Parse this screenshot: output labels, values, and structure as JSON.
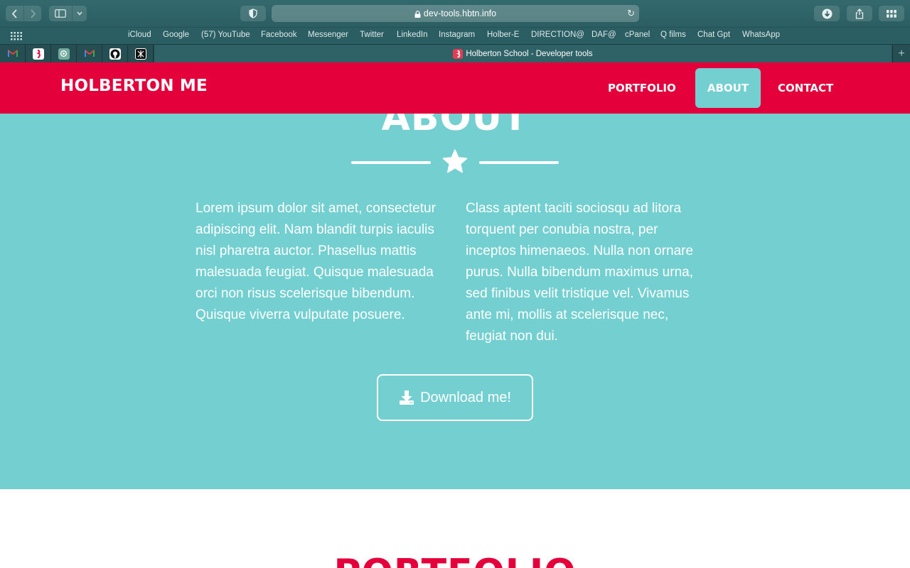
{
  "browser": {
    "url": "dev-tools.hbtn.info",
    "bookmarks": [
      "iCloud",
      "Google",
      "(57) YouTube",
      "Facebook",
      "Messenger",
      "Twitter",
      "LinkedIn",
      "Instagram",
      "Holber-E",
      "DIRECTION@",
      "DAF@",
      "cPanel",
      "Q films",
      "Chat Gpt",
      "WhatsApp"
    ],
    "active_tab_title": "Holberton School - Developer tools",
    "pinned_tabs": [
      "gmail-icon",
      "holberton-icon",
      "chatgpt-icon",
      "gmail-icon",
      "github-icon",
      "app-icon"
    ],
    "new_tab_symbol": "+"
  },
  "site": {
    "brand": "HOLBERTON ME",
    "nav": {
      "portfolio": "PORTFOLIO",
      "about": "ABOUT",
      "contact": "CONTACT"
    },
    "active_nav": "ABOUT",
    "colors": {
      "primary": "#e4003b",
      "secondary": "#74cfd1",
      "text_light": "#ffffff"
    }
  },
  "about": {
    "title": "ABOUT",
    "col1": "Lorem ipsum dolor sit amet, consectetur adipiscing elit. Nam blandit turpis iaculis nisl pharetra auctor. Phasellus mattis malesuada feugiat. Quisque malesuada orci non risus scelerisque bibendum. Quisque viverra vulputate posuere.",
    "col2": "Class aptent taciti sociosqu ad litora torquent per conubia nostra, per inceptos himenaeos. Nulla non ornare purus. Nulla bibendum maximus urna, sed finibus velit tristique vel. Vivamus ante mi, mollis at scelerisque nec, feugiat non dui.",
    "download_label": "Download me!"
  },
  "portfolio": {
    "title": "PORTFOLIO"
  }
}
